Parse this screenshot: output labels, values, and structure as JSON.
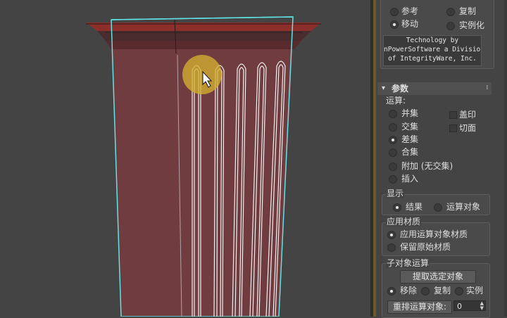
{
  "viewport": {
    "colors": {
      "background": "#444444",
      "body": "#703c3f",
      "cap": "#8a2e2a",
      "wireframe": "#5fe3e6",
      "cursor_highlight": "#d4b030"
    }
  },
  "panel": {
    "top_options": {
      "reference_label": "参考",
      "copy_label": "复制",
      "move_label": "移动",
      "instance_label": "实例化",
      "selected": "move"
    },
    "credit_lines": [
      "Technology by",
      "nPowerSoftware a Divisior",
      "of IntegrityWare, Inc."
    ],
    "params": {
      "title": "参数",
      "collapse_glyph": "▾",
      "operation_heading": "运算:",
      "operations": [
        "并集",
        "交集",
        "差集",
        "合集",
        "附加 (无交集)",
        "插入"
      ],
      "operation_selected": 2,
      "imprint_label": "盖印",
      "cut_label": "切面",
      "display_heading": "显示",
      "display_result": "结果",
      "display_operands": "运算对象",
      "material_heading": "应用材质",
      "material_apply": "应用运算对象材质",
      "material_keep": "保留原始材质",
      "subobject_heading": "子对象运算",
      "extract_button": "提取选定对象",
      "extract_move": "移除",
      "extract_copy": "复制",
      "extract_instance": "实例",
      "reorder_button": "重排运算对象:",
      "reorder_value": "0"
    }
  }
}
